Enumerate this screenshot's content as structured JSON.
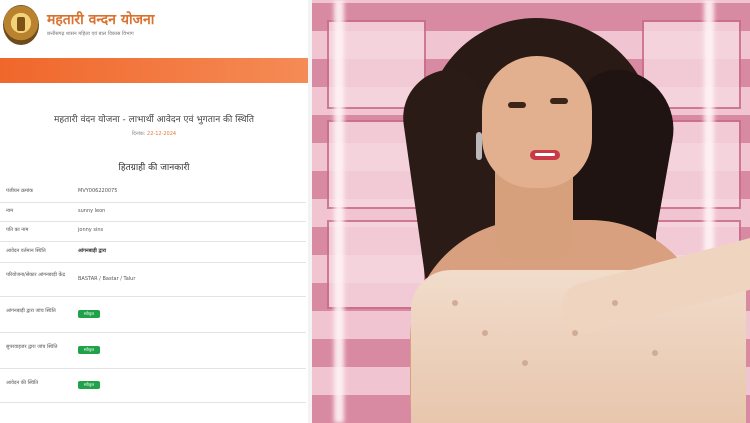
{
  "left": {
    "header": {
      "title": "महतारी वन्दन योजना",
      "subtitle": "छत्तीसगढ़ शासन महिला एवं बाल विकास विभाग"
    },
    "page": {
      "title": "महतारी वंदन योजना - लाभार्थी आवेदन एवं भुगतान की स्थिति",
      "date_label": "दिनांक:",
      "date_value": "22-12-2024"
    },
    "section": {
      "title": "हितग्राही की जानकारी"
    },
    "rows": [
      {
        "label": "पंजीयन क्रमांक",
        "value": "MVY006220075",
        "type": "text"
      },
      {
        "label": "नाम",
        "value": "sunny leon",
        "type": "text"
      },
      {
        "label": "पति का नाम",
        "value": "jonny sins",
        "type": "text"
      },
      {
        "label": "आवेदन वर्तमान स्थिति",
        "value": "आंगनबाड़ी द्वारा",
        "type": "bold"
      },
      {
        "label": "परियोजना/सेक्टर आंगनबाड़ी केंद्र",
        "value": "BASTAR / Bastar / Talur",
        "type": "text"
      },
      {
        "label": "आंगनबाड़ी द्वारा जांच स्थिति",
        "value": "स्वीकृत",
        "type": "badge"
      },
      {
        "label": "सुपरवाइजर द्वारा जांच स्थिति",
        "value": "स्वीकृत",
        "type": "badge"
      },
      {
        "label": "आवेदन की स्थिति",
        "value": "स्वीकृत",
        "type": "badge"
      }
    ]
  },
  "colors": {
    "accent": "#d9722f",
    "orange_bar": "#f0672b",
    "approved_badge": "#1fa24a"
  },
  "photo": {
    "subject": "woman-in-gold-saree",
    "background": "pink-window-panels"
  }
}
